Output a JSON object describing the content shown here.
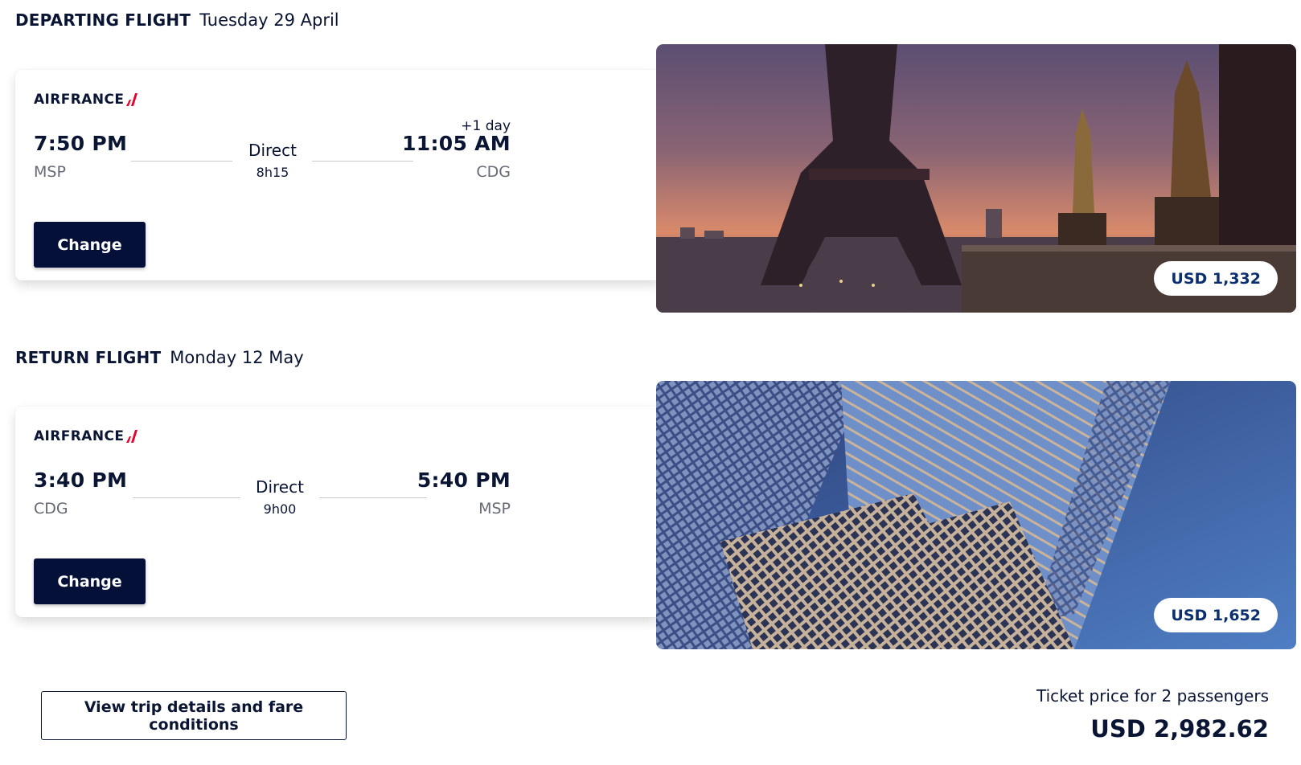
{
  "departing": {
    "heading_label": "DEPARTING FLIGHT",
    "heading_date": "Tuesday 29 April",
    "airline": "AIRFRANCE",
    "dep_time": "7:50 PM",
    "dep_airport": "MSP",
    "stops": "Direct",
    "duration": "8h15",
    "plus_day": "+1 day",
    "arr_time": "11:05 AM",
    "arr_airport": "CDG",
    "change_label": "Change",
    "price": "USD 1,332",
    "image": "eiffel-tower-sunset-photo"
  },
  "return": {
    "heading_label": "RETURN FLIGHT",
    "heading_date": "Monday 12 May",
    "airline": "AIRFRANCE",
    "dep_time": "3:40 PM",
    "dep_airport": "CDG",
    "stops": "Direct",
    "duration": "9h00",
    "arr_time": "5:40 PM",
    "arr_airport": "MSP",
    "change_label": "Change",
    "price": "USD 1,652",
    "image": "skyscraper-photo"
  },
  "footer": {
    "details_button": "View trip details and fare conditions",
    "ticket_label": "Ticket price for 2 passengers",
    "ticket_total": "USD 2,982.62"
  },
  "colors": {
    "navy": "#051039",
    "text": "#0a1433",
    "price_text": "#0a2e6e",
    "airfrance_red": "#e4002b"
  }
}
